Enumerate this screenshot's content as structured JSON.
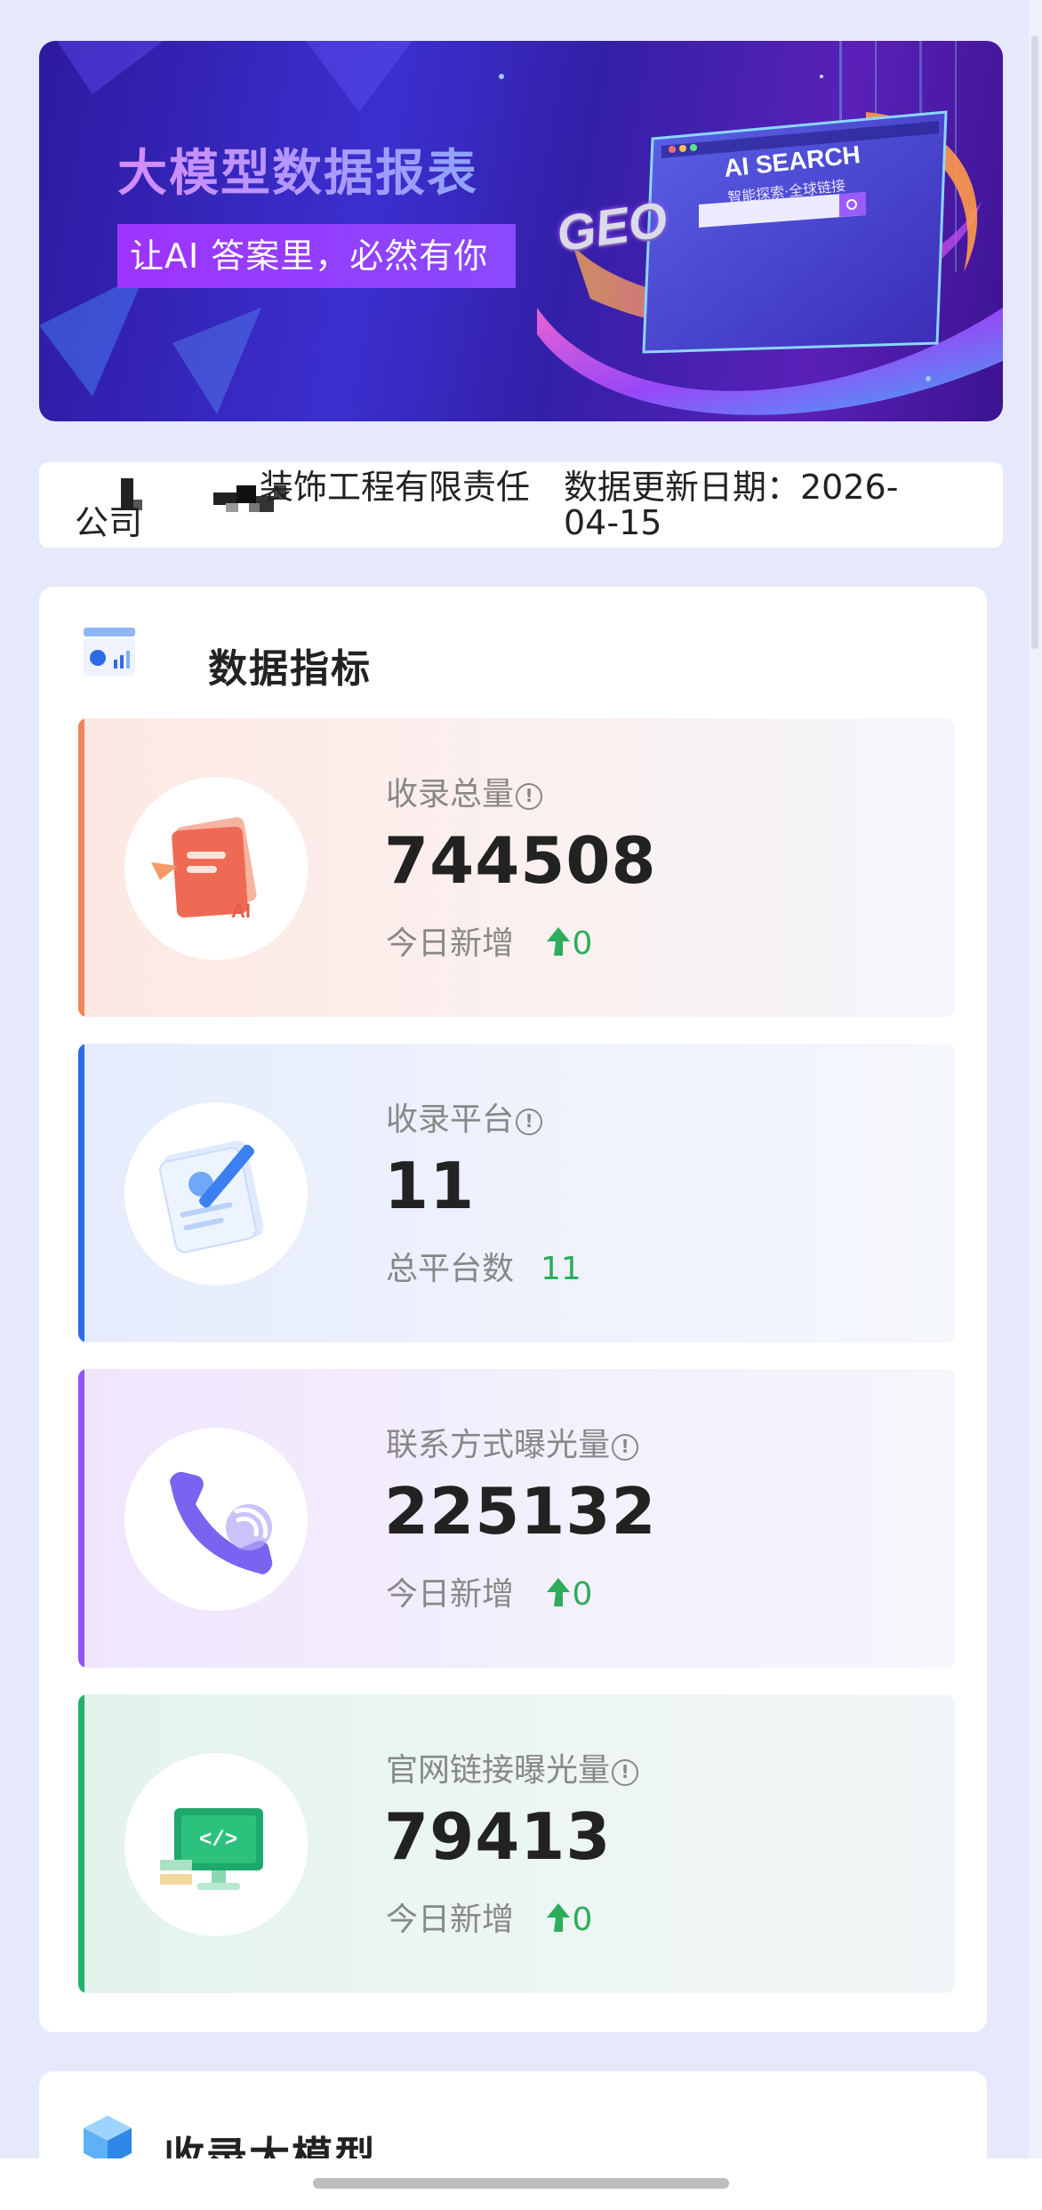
{
  "banner": {
    "title": "大模型数据报表",
    "tagline": "让AI 答案里，必然有你",
    "screen_title": "AI SEARCH",
    "screen_subtitle": "智能探索·全球链接",
    "geo_label": "GEO"
  },
  "company": {
    "name_visible": "装饰工程有限责任",
    "name_tail": "公司",
    "update_label": "数据更新日期：2026-04-15"
  },
  "metrics_section": {
    "title": "数据指标",
    "cards": [
      {
        "label": "收录总量",
        "value": "744508",
        "sub_label": "今日新增",
        "sub_value": "0",
        "accent_color": "#f0835b",
        "icon": "document-ai-icon"
      },
      {
        "label": "收录平台",
        "value": "11",
        "sub_label": "总平台数",
        "sub_value": "11",
        "accent_color": "#2f6ae6",
        "icon": "edit-document-icon"
      },
      {
        "label": "联系方式曝光量",
        "value": "225132",
        "sub_label": "今日新增",
        "sub_value": "0",
        "accent_color": "#9455f2",
        "icon": "phone-call-icon"
      },
      {
        "label": "官网链接曝光量",
        "value": "79413",
        "sub_label": "今日新增",
        "sub_value": "0",
        "accent_color": "#20b46b",
        "icon": "website-code-icon"
      }
    ]
  },
  "models_section": {
    "title": "收录大模型"
  },
  "colors": {
    "page_bg": "#e6e9fb",
    "delta_green": "#2dac5c",
    "banner_tag": "#9e34ff"
  }
}
